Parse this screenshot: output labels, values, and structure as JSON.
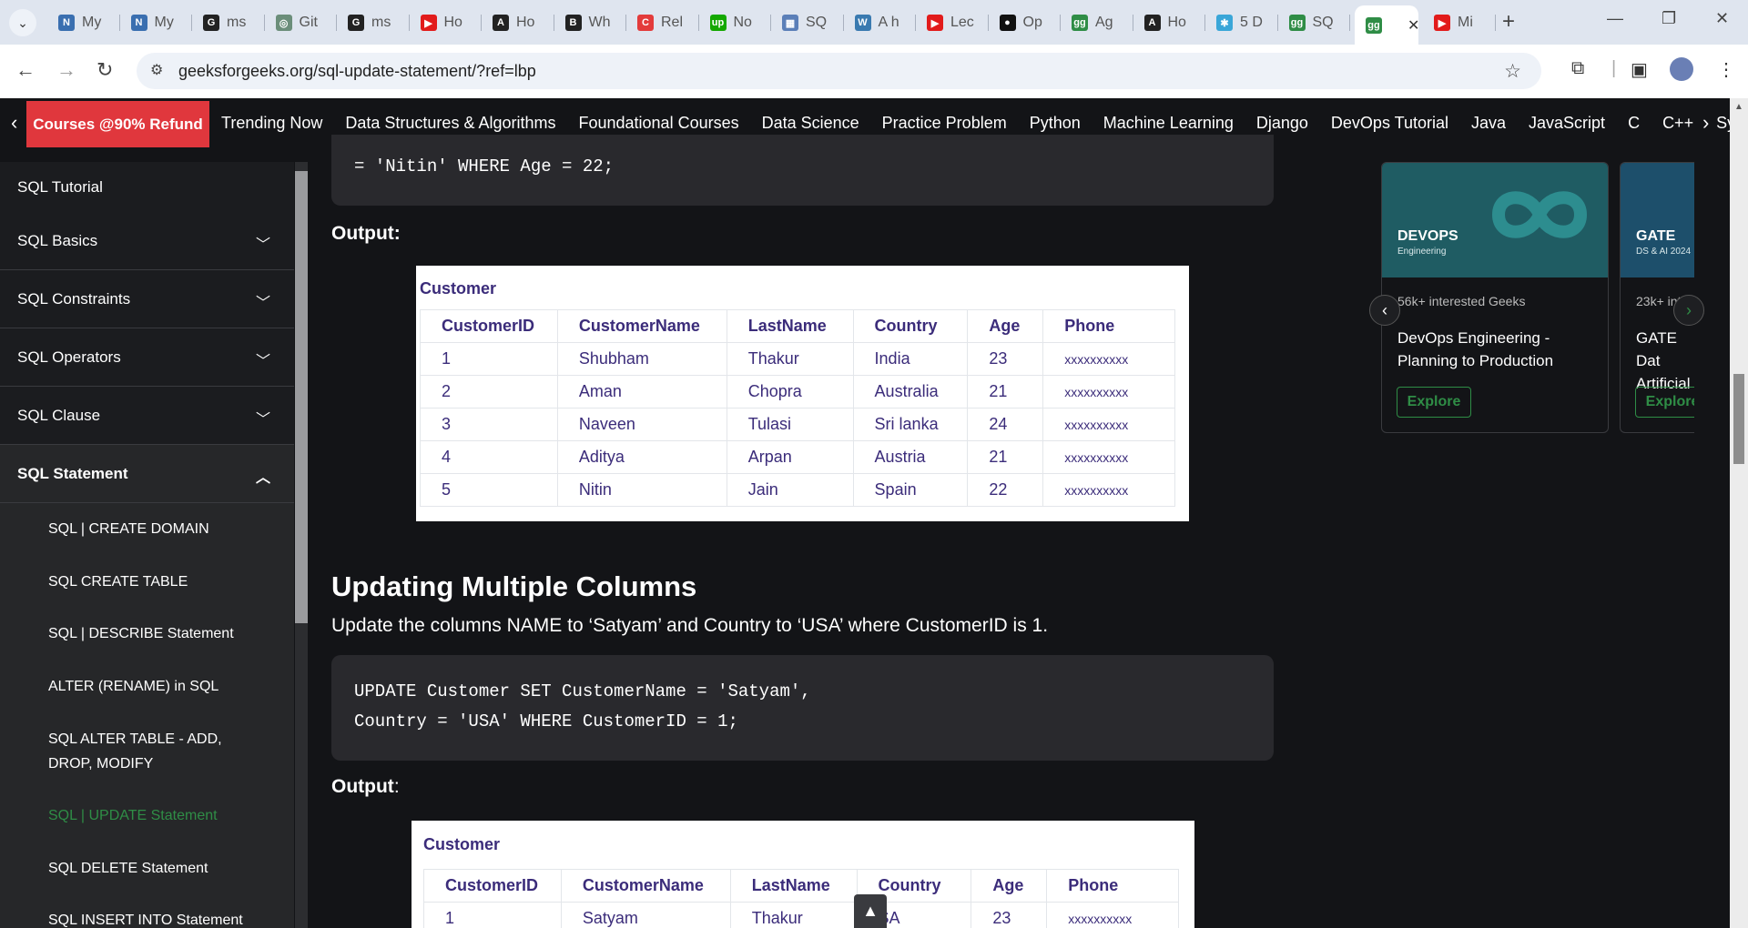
{
  "browser": {
    "tabs": [
      {
        "label": "My",
        "fav": "N",
        "color": "#3a6fb0"
      },
      {
        "label": "My",
        "fav": "N",
        "color": "#3a6fb0"
      },
      {
        "label": "ms",
        "fav": "G",
        "color": "#222222"
      },
      {
        "label": "Git",
        "fav": "◎",
        "color": "#6b8e7a"
      },
      {
        "label": "ms",
        "fav": "G",
        "color": "#222222"
      },
      {
        "label": "Ho",
        "fav": "▶",
        "color": "#e21b1b"
      },
      {
        "label": "Ho",
        "fav": "A",
        "color": "#222222"
      },
      {
        "label": "Wh",
        "fav": "B",
        "color": "#222222"
      },
      {
        "label": "Rel",
        "fav": "C",
        "color": "#e33b3b"
      },
      {
        "label": "No",
        "fav": "up",
        "color": "#14a800"
      },
      {
        "label": "SQ",
        "fav": "▦",
        "color": "#5b7fb8"
      },
      {
        "label": "A h",
        "fav": "W",
        "color": "#3a7ab0"
      },
      {
        "label": "Lec",
        "fav": "▶",
        "color": "#e21b1b"
      },
      {
        "label": "Op",
        "fav": "●",
        "color": "#111111"
      },
      {
        "label": "Ag",
        "fav": "gg",
        "color": "#2f8d46"
      },
      {
        "label": "Ho",
        "fav": "A",
        "color": "#222222"
      },
      {
        "label": "5 D",
        "fav": "✱",
        "color": "#3aa6d8"
      },
      {
        "label": "SQ",
        "fav": "gg",
        "color": "#2f8d46"
      },
      {
        "label": "",
        "fav": "gg",
        "color": "#2f8d46"
      },
      {
        "label": "Mi",
        "fav": "▶",
        "color": "#e21b1b"
      }
    ],
    "url": "geeksforgeeks.org/sql-update-statement/?ref=lbp"
  },
  "gfgnav": {
    "courses": "Courses @90% Refund",
    "items": [
      "Trending Now",
      "Data Structures & Algorithms",
      "Foundational Courses",
      "Data Science",
      "Practice Problem",
      "Python",
      "Machine Learning",
      "Django",
      "DevOps Tutorial",
      "Java",
      "JavaScript",
      "C",
      "C++",
      "System"
    ]
  },
  "sidebar": {
    "sections": [
      "SQL Tutorial",
      "SQL Basics",
      "SQL Constraints",
      "SQL Operators",
      "SQL Clause",
      "SQL Statement"
    ],
    "subitems": [
      "SQL | CREATE DOMAIN",
      "SQL CREATE TABLE",
      "SQL | DESCRIBE Statement",
      "ALTER (RENAME) in SQL",
      "SQL ALTER TABLE - ADD, DROP, MODIFY",
      "SQL | UPDATE Statement",
      "SQL DELETE Statement",
      "SQL INSERT INTO Statement"
    ]
  },
  "content": {
    "code1": "= 'Nitin' WHERE Age = 22;",
    "output1": "Output:",
    "table1": {
      "caption": "Customer",
      "headers": [
        "CustomerID",
        "CustomerName",
        "LastName",
        "Country",
        "Age",
        "Phone"
      ],
      "rows": [
        [
          "1",
          "Shubham",
          "Thakur",
          "India",
          "23",
          "xxxxxxxxxx"
        ],
        [
          "2",
          "Aman",
          "Chopra",
          "Australia",
          "21",
          "xxxxxxxxxx"
        ],
        [
          "3",
          "Naveen",
          "Tulasi",
          "Sri lanka",
          "24",
          "xxxxxxxxxx"
        ],
        [
          "4",
          "Aditya",
          "Arpan",
          "Austria",
          "21",
          "xxxxxxxxxx"
        ],
        [
          "5",
          "Nitin",
          "Jain",
          "Spain",
          "22",
          "xxxxxxxxxx"
        ]
      ]
    },
    "heading": "Updating Multiple Columns",
    "paragraph": "Update the columns NAME to ‘Satyam’ and Country to ‘USA’ where CustomerID is 1.",
    "code2_line1": "UPDATE Customer SET CustomerName = 'Satyam',",
    "code2_line2": "Country = 'USA' WHERE CustomerID = 1;",
    "output2": "Output",
    "output2_colon": ":",
    "table2": {
      "caption": "Customer",
      "headers": [
        "CustomerID",
        "CustomerName",
        "LastName",
        "Country",
        "Age",
        "Phone"
      ],
      "rows": [
        [
          "1",
          "Satyam",
          "Thakur",
          "SA",
          "23",
          "xxxxxxxxxx"
        ]
      ]
    }
  },
  "cards": [
    {
      "banner_title": "DEVOPS",
      "banner_sub": "Engineering",
      "interest": "56k+ interested Geeks",
      "title": "DevOps Engineering - Planning to Production",
      "cta": "Explore"
    },
    {
      "banner_title": "GATE",
      "banner_sub": "DS & AI 2024",
      "interest": "23k+ int",
      "title": "GATE Dat Artificial",
      "cta": "Explore"
    }
  ]
}
